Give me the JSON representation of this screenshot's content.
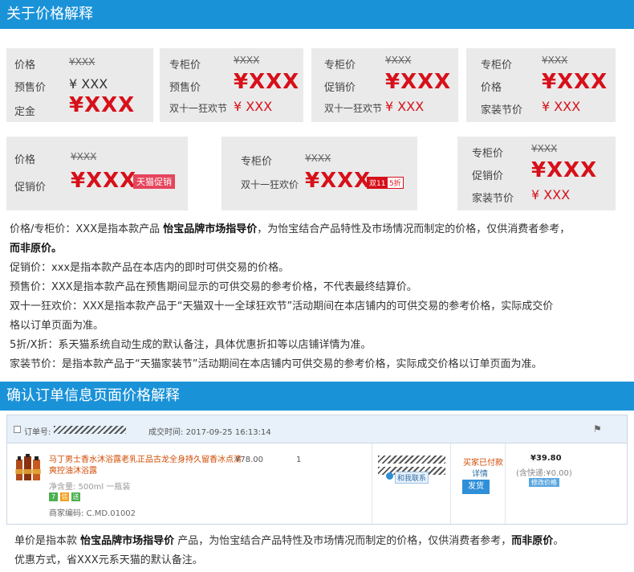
{
  "sections": {
    "price_title": "关于价格解释",
    "order_title": "确认订单信息页面价格解释"
  },
  "boxes": {
    "b1": {
      "r1_label": "价格",
      "r1_value": "¥XXX",
      "r2_label": "预售价",
      "r2_value": "¥ XXX",
      "r3_label": "定金",
      "r3_value": "¥XXX"
    },
    "b2": {
      "r1_label": "专柜价",
      "r1_value": "¥XXX",
      "r2_label": "预售价",
      "r2_value": "¥XXX",
      "r3_label": "双十一狂欢节",
      "r3_value": "¥ XXX"
    },
    "b3": {
      "r1_label": "专柜价",
      "r1_value": "¥XXX",
      "r2_label": "促销价",
      "r2_value": "¥XXX",
      "r3_label": "双十一狂欢节",
      "r3_value": "¥ XXX"
    },
    "b4": {
      "r1_label": "专柜价",
      "r1_value": "¥XXX",
      "r2_label": "价格",
      "r2_value": "¥XXX",
      "r3_label": "家装节价",
      "r3_value": "¥ XXX"
    },
    "b5": {
      "r1_label": "价格",
      "r1_value": "¥XXX",
      "r2_label": "促销价",
      "r2_value": "¥XXX",
      "tag": "天猫促销"
    },
    "b6": {
      "r1_label": "专柜价",
      "r1_value": "¥XXX",
      "r2_label": "双十一狂欢价",
      "r2_value": "¥XXX",
      "tag1": "双11",
      "tag2": "5折"
    },
    "b7": {
      "r1_label": "专柜价",
      "r1_value": "¥XXX",
      "r2_label": "促销价",
      "r2_value": "¥XXX",
      "r3_label": "家装节价",
      "r3_value": "¥ XXX"
    }
  },
  "explanations": {
    "l1_a": "价格/专柜价：XXX是指本款产品 ",
    "l1_b": "怡宝品牌市场指导价",
    "l1_c": "，为怡宝结合产品特性及市场情况而制定的价格，仅供消费者参考，",
    "l2": "而非原价。",
    "l3": "促销价：xxx是指本款产品在本店内的即时可供交易的价格。",
    "l4": "预售价：XXX是指本款产品在预售期间显示的可供交易的参考价格，不代表最终结算价。",
    "l5": "双十一狂欢价：XXX是指本款产品于“天猫双十一全球狂欢节”活动期间在本店铺内的可供交易的参考价格，实际成交价",
    "l6": "格以订单页面为准。",
    "l7": "5折/X折：系天猫系统自动生成的默认备注，具体优惠折扣等以店铺详情为准。",
    "l8": "家装节价：是指本款产品于“天猫家装节”活动期间在本店铺内可供交易的参考价格，实际成交价格以订单页面为准。"
  },
  "order": {
    "order_no_label": "订单号:",
    "deal_time": "成交时间: 2017-09-25 16:13:14",
    "product_name_1": "马丁男士香水沐浴露老乳正品古龙全身持久留香冰点清",
    "product_name_2": "爽控油沐浴露",
    "net_content": "净含量: 500ml 一瓶装",
    "merchant_code": "商家编码: C.MD.01002",
    "unit_price": "¥78.00",
    "quantity": "1",
    "contact_seller": "和我联系",
    "status": "买家已付款",
    "details": "详情",
    "ship_button": "发货",
    "total": "¥39.80",
    "shipping": "(含快递:¥0.00)",
    "modify_price": "修改价格",
    "badges": [
      "7",
      "信",
      "送"
    ]
  },
  "footer": {
    "l1_a": "单价是指本款 ",
    "l1_b": "怡宝品牌市场指导价",
    "l1_c": " 产品，为怡宝结合产品特性及市场情况而制定的价格，仅供消费者参考，",
    "l1_d": "而非原价",
    "l1_e": "。",
    "l2": "优惠方式，省XXX元系天猫的默认备注。"
  }
}
